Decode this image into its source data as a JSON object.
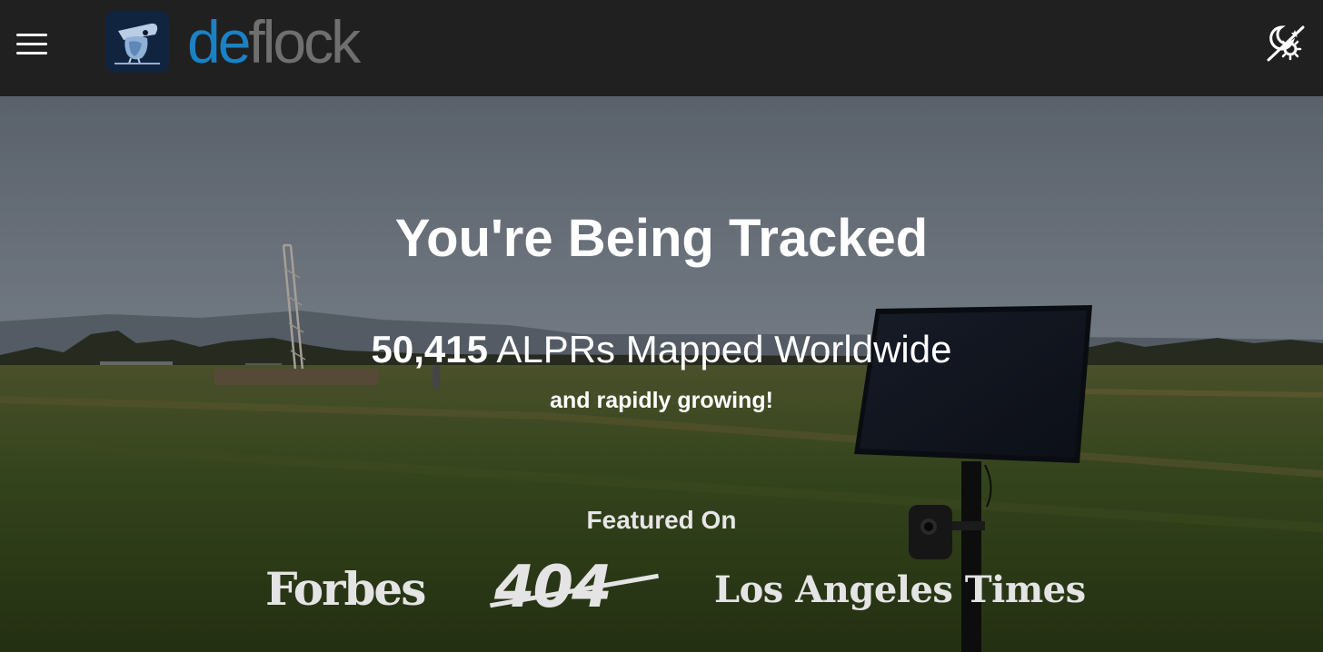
{
  "header": {
    "menu_icon": "hamburger-menu-icon",
    "logo_icon": "bird-logo-icon",
    "brand_prefix": "de",
    "brand_suffix": "flock",
    "theme_icon": "theme-toggle-sun-moon-icon",
    "colors": {
      "background": "#202020",
      "brand_blue": "#1a82c4",
      "brand_gray": "#6f6f6f",
      "badge": "#11243f"
    }
  },
  "hero": {
    "title": "You're Being Tracked",
    "count": "50,415",
    "count_label": "ALPRs Mapped Worldwide",
    "subtitle": "and rapidly growing!",
    "featured_label": "Featured On",
    "publications": [
      "Forbes",
      "404",
      "Los Angeles Times"
    ]
  }
}
